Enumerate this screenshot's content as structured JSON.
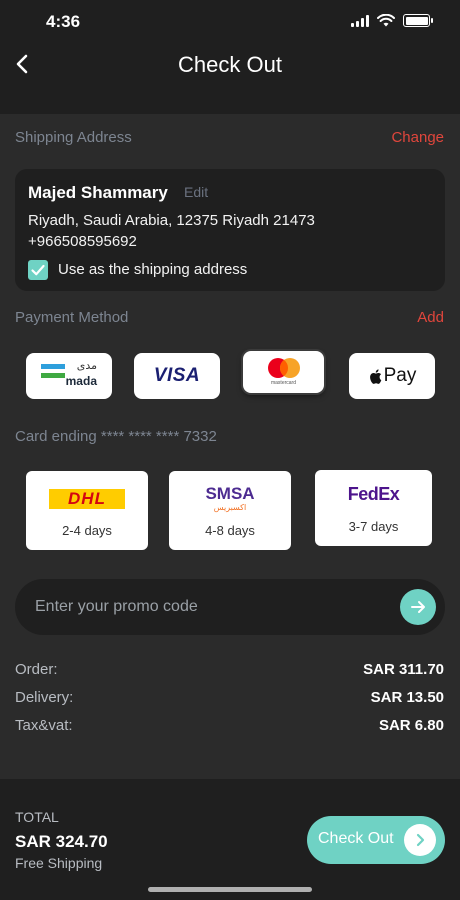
{
  "status_bar": {
    "time": "4:36"
  },
  "header": {
    "title": "Check Out"
  },
  "shipping_address": {
    "label": "Shipping Address",
    "action": "Change",
    "name": "Majed Shammary",
    "edit_label": "Edit",
    "address_line": "Riyadh, Saudi Arabia, 12375 Riyadh 21473",
    "phone": "+966508595692",
    "checkbox_label": "Use as the shipping address",
    "checkbox_checked": true
  },
  "payment_method": {
    "label": "Payment Method",
    "action": "Add",
    "cards": [
      {
        "name": "mada",
        "label": "mada",
        "arabic_label": "مدى",
        "selected": false
      },
      {
        "name": "visa",
        "label": "VISA",
        "selected": false
      },
      {
        "name": "mastercard",
        "label": "mastercard",
        "selected": true
      },
      {
        "name": "apple-pay",
        "label": "Pay",
        "selected": false
      }
    ],
    "card_ending": "Card ending **** **** **** 7332"
  },
  "shipping_options": [
    {
      "carrier": "DHL",
      "days": "2-4 days",
      "selected": false
    },
    {
      "carrier": "SMSA",
      "days": "4-8 days",
      "selected": false,
      "arabic_label": "اكسبريس"
    },
    {
      "carrier": "FedEx",
      "days": "3-7 days",
      "selected": true
    }
  ],
  "promo": {
    "placeholder": "Enter your promo code"
  },
  "summary": {
    "order_label": "Order:",
    "order_value": "SAR 311.70",
    "delivery_label": "Delivery:",
    "delivery_value": "SAR 13.50",
    "tax_label": "Tax&vat:",
    "tax_value": "SAR 6.80"
  },
  "footer": {
    "total_label": "TOTAL",
    "total_value": "SAR 324.70",
    "note": "Free Shipping",
    "checkout_label": "Check Out"
  },
  "colors": {
    "accent": "#6fd2c4",
    "action_red": "#e0463c",
    "background": "#2b2b2b",
    "card_dark": "#1f1f1f"
  }
}
